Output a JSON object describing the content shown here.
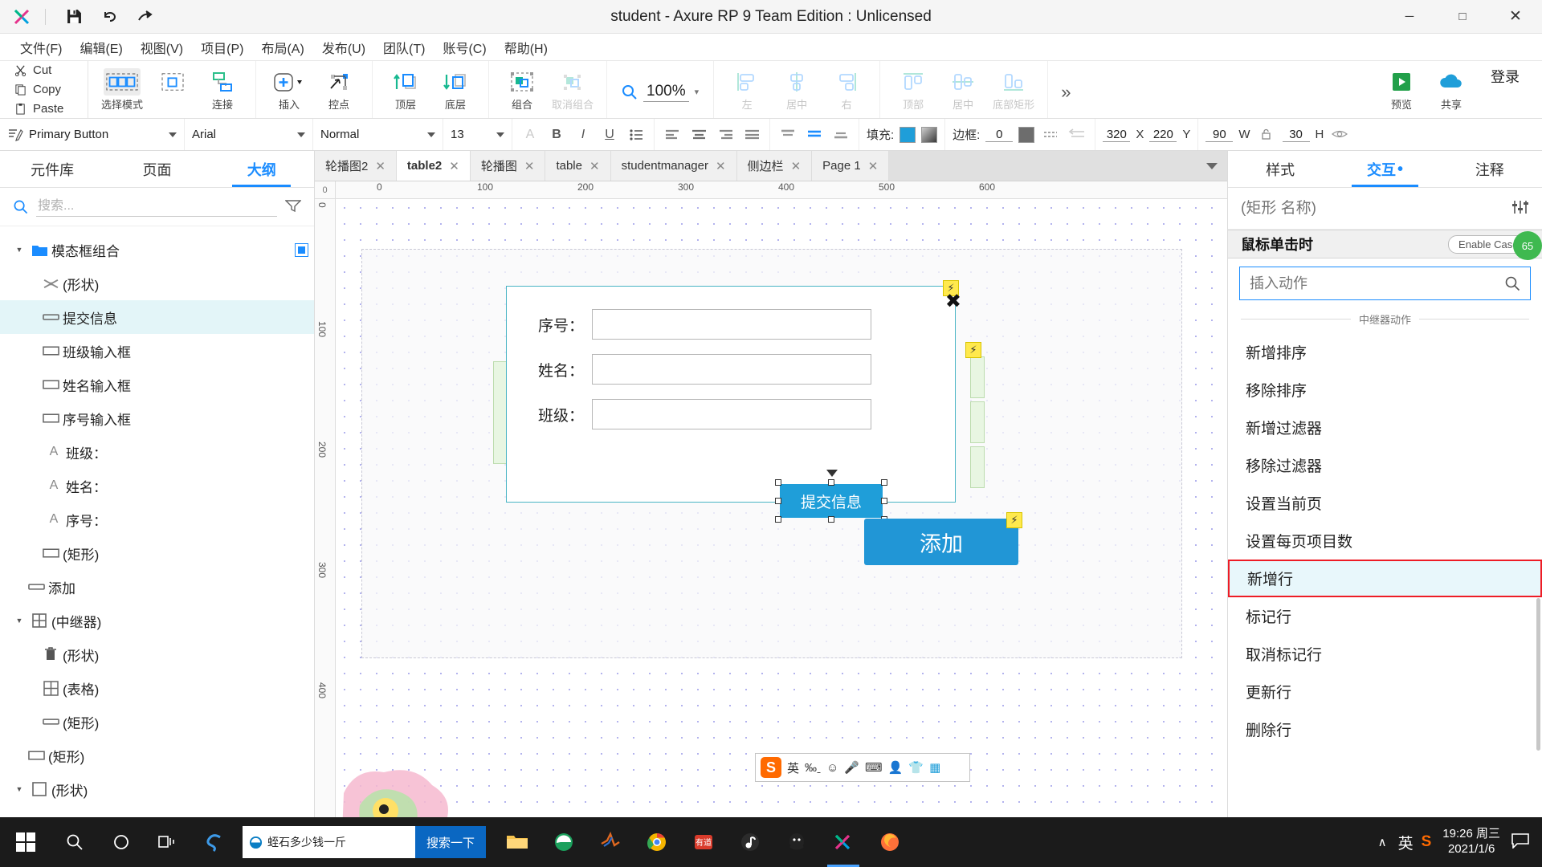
{
  "window": {
    "title": "student - Axure RP 9 Team Edition : Unlicensed",
    "minimize": "─",
    "maximize": "□",
    "close": "✕"
  },
  "quick_access": {
    "save": "save-icon",
    "undo": "undo-icon",
    "redo": "redo-icon"
  },
  "menu": [
    "文件(F)",
    "编辑(E)",
    "视图(V)",
    "项目(P)",
    "布局(A)",
    "发布(U)",
    "团队(T)",
    "账号(C)",
    "帮助(H)"
  ],
  "clipboard": {
    "cut": "Cut",
    "copy": "Copy",
    "paste": "Paste"
  },
  "toolbar": {
    "items": [
      {
        "label": "选择模式",
        "icon": "select-mode-icon",
        "enabled": true,
        "active": true
      },
      {
        "label": "",
        "icon": "marquee-icon",
        "enabled": true,
        "active": false
      },
      {
        "label": "连接",
        "icon": "connect-icon",
        "enabled": true,
        "active": false
      },
      {
        "label": "插入",
        "icon": "insert-plus-icon",
        "enabled": true,
        "active": false
      },
      {
        "label": "控点",
        "icon": "control-point-icon",
        "enabled": true,
        "active": false
      },
      {
        "label": "顶层",
        "icon": "bring-front-icon",
        "enabled": true,
        "active": false
      },
      {
        "label": "底层",
        "icon": "send-back-icon",
        "enabled": true,
        "active": false
      },
      {
        "label": "组合",
        "icon": "group-icon",
        "enabled": true,
        "active": false
      },
      {
        "label": "取消组合",
        "icon": "ungroup-icon",
        "enabled": false,
        "active": false
      }
    ],
    "zoom": {
      "label": "100%",
      "icon": "zoom-icon"
    },
    "align_h": [
      {
        "label": "左",
        "icon": "align-left-icon"
      },
      {
        "label": "居中",
        "icon": "align-center-icon"
      },
      {
        "label": "右",
        "icon": "align-right-icon"
      }
    ],
    "align_v": [
      {
        "label": "顶部",
        "icon": "align-top-icon"
      },
      {
        "label": "居中",
        "icon": "align-middle-icon"
      },
      {
        "label": "底部矩形",
        "icon": "align-bottom-icon"
      }
    ],
    "overflow": "»",
    "preview": "预览",
    "share": "共享",
    "login": "登录"
  },
  "style_bar": {
    "widget_style": "Primary Button",
    "font_family": "Arial",
    "font_weight": "Normal",
    "font_size": "13",
    "fill_label": "填充:",
    "fill_color": "#1f9ed9",
    "border_label": "边框:",
    "border_width": "0",
    "border_color": "#6d6d6d",
    "x_value": "320",
    "x_label": "X",
    "y_value": "220",
    "y_label": "Y",
    "w_value": "90",
    "w_label": "W",
    "h_value": "30",
    "h_label": "H"
  },
  "left_panel": {
    "tabs": [
      {
        "label": "元件库",
        "active": false
      },
      {
        "label": "页面",
        "active": false
      },
      {
        "label": "大纲",
        "active": true
      }
    ],
    "search_placeholder": "搜索...",
    "tree": [
      {
        "label": "模态框组合",
        "icon": "folder-icon",
        "depth": 0,
        "expanded": true,
        "selected": false,
        "checkbox": true
      },
      {
        "label": "(形状)",
        "icon": "shape-icon",
        "depth": 1,
        "selected": false
      },
      {
        "label": "提交信息",
        "icon": "button-icon",
        "depth": 1,
        "selected": true
      },
      {
        "label": "班级输入框",
        "icon": "rect-icon",
        "depth": 1,
        "selected": false
      },
      {
        "label": "姓名输入框",
        "icon": "rect-icon",
        "depth": 1,
        "selected": false
      },
      {
        "label": "序号输入框",
        "icon": "rect-icon",
        "depth": 1,
        "selected": false
      },
      {
        "label": "班级：",
        "icon": "text-icon",
        "depth": 1,
        "selected": false
      },
      {
        "label": "姓名：",
        "icon": "text-icon",
        "depth": 1,
        "selected": false
      },
      {
        "label": "序号：",
        "icon": "text-icon",
        "depth": 1,
        "selected": false
      },
      {
        "label": "(矩形)",
        "icon": "rect-icon",
        "depth": 1,
        "selected": false
      },
      {
        "label": "添加",
        "icon": "button-icon",
        "depth": 0,
        "selected": false
      },
      {
        "label": "(中继器)",
        "icon": "repeater-icon",
        "depth": 0,
        "expanded": true,
        "selected": false
      },
      {
        "label": "(形状)",
        "icon": "trash-icon",
        "depth": 1,
        "selected": false
      },
      {
        "label": "(表格)",
        "icon": "table-icon",
        "depth": 1,
        "selected": false
      },
      {
        "label": "(矩形)",
        "icon": "button-icon",
        "depth": 1,
        "selected": false
      },
      {
        "label": "(矩形)",
        "icon": "rect-icon",
        "depth": 0,
        "selected": false
      },
      {
        "label": "(形状)",
        "icon": "rect-icon",
        "depth": 0,
        "selected": false
      }
    ]
  },
  "page_tabs": [
    {
      "label": "轮播图2",
      "active": false
    },
    {
      "label": "table2",
      "active": true
    },
    {
      "label": "轮播图",
      "active": false
    },
    {
      "label": "table",
      "active": false
    },
    {
      "label": "studentmanager",
      "active": false
    },
    {
      "label": "侧边栏",
      "active": false
    },
    {
      "label": "Page 1",
      "active": false
    }
  ],
  "canvas": {
    "corner_label": "0",
    "h_ruler_ticks": [
      "0",
      "100",
      "200",
      "300",
      "400",
      "500",
      "600"
    ],
    "v_ruler_ticks": [
      "0",
      "100",
      "200",
      "300",
      "400"
    ],
    "modal": {
      "fields": [
        {
          "label": "序号：",
          "value": ""
        },
        {
          "label": "姓名：",
          "value": ""
        },
        {
          "label": "班级：",
          "value": ""
        }
      ],
      "submit_label": "提交信息"
    },
    "add_button_label": "添加",
    "ime": {
      "logo": "S",
      "mode": "英",
      "items": [
        "‰ˍ",
        "☺",
        "🎤",
        "⌨",
        "👤",
        "👕",
        "▦"
      ]
    }
  },
  "right_panel": {
    "tabs": [
      {
        "label": "样式",
        "active": false,
        "dot": false
      },
      {
        "label": "交互",
        "active": true,
        "dot": true
      },
      {
        "label": "注释",
        "active": false,
        "dot": false
      }
    ],
    "name_placeholder": "(矩形 名称)",
    "event_name": "鼠标单击时",
    "enable_cases": "Enable Cases",
    "action_search_placeholder": "插入动作",
    "group_label": "中继器动作",
    "actions": [
      {
        "label": "新增排序",
        "selected": false
      },
      {
        "label": "移除排序",
        "selected": false
      },
      {
        "label": "新增过滤器",
        "selected": false
      },
      {
        "label": "移除过滤器",
        "selected": false
      },
      {
        "label": "设置当前页",
        "selected": false
      },
      {
        "label": "设置每页项目数",
        "selected": false
      },
      {
        "label": "新增行",
        "selected": true
      },
      {
        "label": "标记行",
        "selected": false
      },
      {
        "label": "取消标记行",
        "selected": false
      },
      {
        "label": "更新行",
        "selected": false
      },
      {
        "label": "删除行",
        "selected": false
      }
    ],
    "help_badge": "65"
  },
  "taskbar": {
    "search_value": "蛭石多少钱一斤",
    "search_button": "搜索一下",
    "ime_lang": "英",
    "ime_logo": "S",
    "clock_time": "19:26 周三",
    "clock_date": "2021/1/6",
    "chevron": "∧",
    "apps": [
      {
        "name": "sogou-input-icon"
      },
      {
        "name": "file-explorer-icon"
      },
      {
        "name": "edge-icon"
      },
      {
        "name": "matlab-icon"
      },
      {
        "name": "chrome-icon"
      },
      {
        "name": "youdao-icon"
      },
      {
        "name": "netease-music-icon"
      },
      {
        "name": "qq-icon"
      },
      {
        "name": "axure-icon"
      },
      {
        "name": "firefox-icon"
      }
    ]
  }
}
